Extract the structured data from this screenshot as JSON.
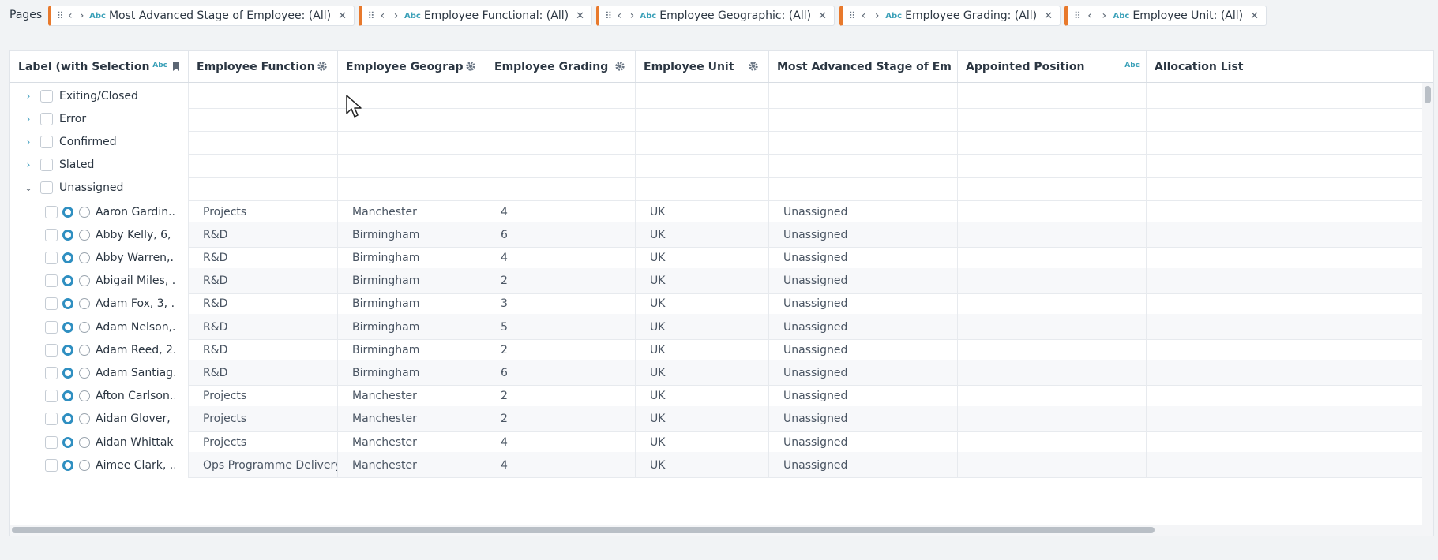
{
  "pages_label": "Pages",
  "filters": [
    {
      "text": "Most Advanced Stage of Employee: (All)",
      "type_badge": "Abc"
    },
    {
      "text": "Employee Functional: (All)",
      "type_badge": "Abc"
    },
    {
      "text": "Employee Geographic: (All)",
      "type_badge": "Abc"
    },
    {
      "text": "Employee Grading: (All)",
      "type_badge": "Abc"
    },
    {
      "text": "Employee Unit: (All)",
      "type_badge": "Abc"
    }
  ],
  "columns": [
    {
      "label": "Label (with Selection Ic...",
      "badge": "Abc"
    },
    {
      "label": "Employee Functional"
    },
    {
      "label": "Employee Geograp..."
    },
    {
      "label": "Employee Grading"
    },
    {
      "label": "Employee Unit"
    },
    {
      "label": "Most Advanced Stage of Empl..."
    },
    {
      "label": "Appointed Position",
      "badge": "Abc"
    },
    {
      "label": "Allocation List"
    }
  ],
  "groups": [
    {
      "label": "Exiting/Closed",
      "expanded": false
    },
    {
      "label": "Error",
      "expanded": false
    },
    {
      "label": "Confirmed",
      "expanded": false
    },
    {
      "label": "Slated",
      "expanded": false
    },
    {
      "label": "Unassigned",
      "expanded": true
    }
  ],
  "rows": [
    {
      "label": "Aaron Gardin...",
      "functional": "Projects",
      "geographic": "Manchester",
      "grading": "4",
      "unit": "UK",
      "stage": "Unassigned"
    },
    {
      "label": "Abby Kelly, 6, ...",
      "functional": "R&D",
      "geographic": "Birmingham",
      "grading": "6",
      "unit": "UK",
      "stage": "Unassigned"
    },
    {
      "label": "Abby Warren,...",
      "functional": "R&D",
      "geographic": "Birmingham",
      "grading": "4",
      "unit": "UK",
      "stage": "Unassigned"
    },
    {
      "label": "Abigail Miles, ...",
      "functional": "R&D",
      "geographic": "Birmingham",
      "grading": "2",
      "unit": "UK",
      "stage": "Unassigned"
    },
    {
      "label": "Adam Fox, 3, ...",
      "functional": "R&D",
      "geographic": "Birmingham",
      "grading": "3",
      "unit": "UK",
      "stage": "Unassigned"
    },
    {
      "label": "Adam Nelson,...",
      "functional": "R&D",
      "geographic": "Birmingham",
      "grading": "5",
      "unit": "UK",
      "stage": "Unassigned"
    },
    {
      "label": "Adam Reed, 2...",
      "functional": "R&D",
      "geographic": "Birmingham",
      "grading": "2",
      "unit": "UK",
      "stage": "Unassigned"
    },
    {
      "label": "Adam Santiag...",
      "functional": "R&D",
      "geographic": "Birmingham",
      "grading": "6",
      "unit": "UK",
      "stage": "Unassigned"
    },
    {
      "label": "Afton Carlson...",
      "functional": "Projects",
      "geographic": "Manchester",
      "grading": "2",
      "unit": "UK",
      "stage": "Unassigned"
    },
    {
      "label": "Aidan Glover, ...",
      "functional": "Projects",
      "geographic": "Manchester",
      "grading": "2",
      "unit": "UK",
      "stage": "Unassigned"
    },
    {
      "label": "Aidan Whittak...",
      "functional": "Projects",
      "geographic": "Manchester",
      "grading": "4",
      "unit": "UK",
      "stage": "Unassigned"
    },
    {
      "label": "Aimee Clark, ...",
      "functional": "Ops Programme Delivery",
      "geographic": "Manchester",
      "grading": "4",
      "unit": "UK",
      "stage": "Unassigned"
    }
  ],
  "colors": {
    "accent": "#e8792c",
    "selected_radio": "#2f8fc1",
    "badge": "#3aa0b8"
  }
}
